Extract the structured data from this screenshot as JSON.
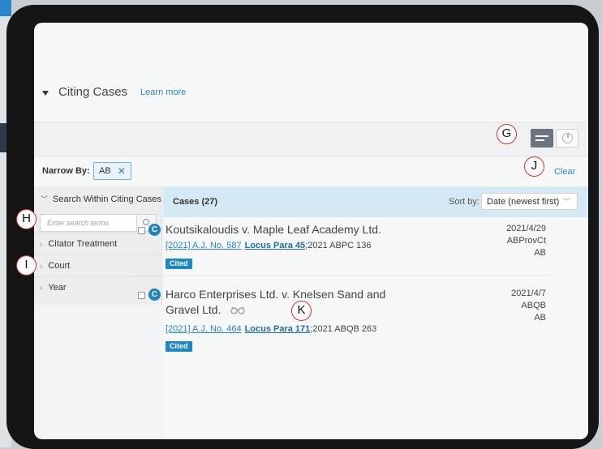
{
  "section": {
    "title": "Citing Cases",
    "learn_more": "Learn more"
  },
  "filters": {
    "narrow_by_label": "Narrow By:",
    "chip_label": "AB",
    "clear_label": "Clear"
  },
  "sidebar": {
    "search_heading": "Search Within Citing Cases",
    "search_placeholder": "Enter search terms",
    "items": [
      {
        "label": "Citator Treatment"
      },
      {
        "label": "Court"
      },
      {
        "label": "Year"
      }
    ]
  },
  "results": {
    "count_label": "Cases (27)",
    "sort_label": "Sort by:",
    "sort_value": "Date (newest first)",
    "items": [
      {
        "title": "Koutsikaloudis v. Maple Leaf Academy Ltd.",
        "citation": "[2021] A.J. No. 587",
        "locus": "Locus Para 45",
        "parallel": ";2021 ABPC 136",
        "badge": "Cited",
        "date": "2021/4/29",
        "court": "ABProvCt",
        "jurisdiction": "AB"
      },
      {
        "title": "Harco Enterprises Ltd. v. Knelsen Sand and Gravel Ltd.",
        "citation": "[2021] A.J. No. 464",
        "locus": "Locus Para 171",
        "parallel": ";2021 ABQB 263",
        "badge": "Cited",
        "date": "2021/4/7",
        "court": "ABQB",
        "jurisdiction": "AB"
      }
    ]
  },
  "markers": {
    "g": "G",
    "h": "H",
    "i": "I",
    "j": "J",
    "k": "K"
  },
  "colors": {
    "accent": "#2a86c9",
    "badge": "#1c88c8",
    "results_header_bg": "#d5e9f4",
    "marker_border": "#d0312d"
  }
}
